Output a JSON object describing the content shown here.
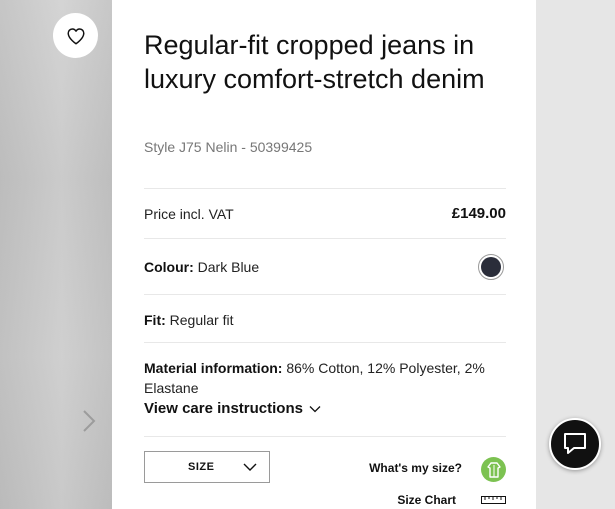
{
  "product": {
    "title": "Regular-fit cropped jeans in luxury comfort-stretch denim",
    "style_number": "Style J75 Nelin - 50399425"
  },
  "price": {
    "label": "Price incl. VAT",
    "value": "£149.00"
  },
  "colour": {
    "label": "Colour:",
    "value": "Dark Blue",
    "swatch_color": "#2a2d3a"
  },
  "fit": {
    "label": "Fit:",
    "value": "Regular fit"
  },
  "material": {
    "label": "Material information:",
    "value": "86% Cotton, 12% Polyester, 2% Elastane",
    "care_link": "View care instructions"
  },
  "size": {
    "select_label": "SIZE",
    "whats_my_size": "What's my size?",
    "size_chart": "Size Chart",
    "accent": "#7cc251"
  },
  "icons": {
    "wishlist": "heart-icon",
    "next": "chevron-right-icon",
    "chat": "chat-bubble-icon",
    "size_advisor": "body-silhouette-icon",
    "size_chart": "ruler-icon"
  }
}
